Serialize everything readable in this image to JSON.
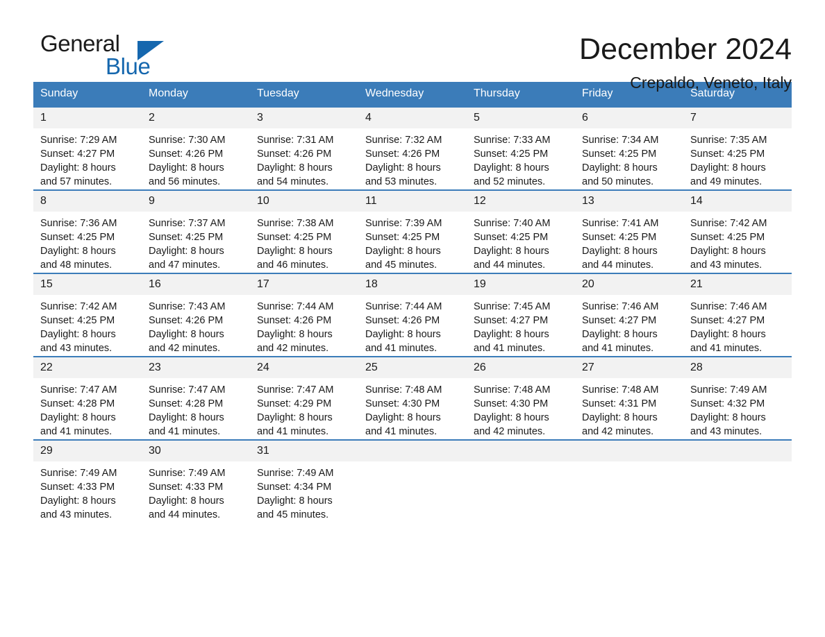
{
  "brand": {
    "name_part1": "General",
    "name_part2": "Blue",
    "triangle_color": "#1567ae"
  },
  "header": {
    "month_title": "December 2024",
    "location": "Crepaldo, Veneto, Italy"
  },
  "theme": {
    "header_blue": "#3b7cb9",
    "daynum_gray": "#f2f2f2",
    "text": "#1a1a1a"
  },
  "weekdays": [
    "Sunday",
    "Monday",
    "Tuesday",
    "Wednesday",
    "Thursday",
    "Friday",
    "Saturday"
  ],
  "weeks": [
    [
      {
        "day": "1",
        "sunrise": "Sunrise: 7:29 AM",
        "sunset": "Sunset: 4:27 PM",
        "daylight1": "Daylight: 8 hours",
        "daylight2": "and 57 minutes."
      },
      {
        "day": "2",
        "sunrise": "Sunrise: 7:30 AM",
        "sunset": "Sunset: 4:26 PM",
        "daylight1": "Daylight: 8 hours",
        "daylight2": "and 56 minutes."
      },
      {
        "day": "3",
        "sunrise": "Sunrise: 7:31 AM",
        "sunset": "Sunset: 4:26 PM",
        "daylight1": "Daylight: 8 hours",
        "daylight2": "and 54 minutes."
      },
      {
        "day": "4",
        "sunrise": "Sunrise: 7:32 AM",
        "sunset": "Sunset: 4:26 PM",
        "daylight1": "Daylight: 8 hours",
        "daylight2": "and 53 minutes."
      },
      {
        "day": "5",
        "sunrise": "Sunrise: 7:33 AM",
        "sunset": "Sunset: 4:25 PM",
        "daylight1": "Daylight: 8 hours",
        "daylight2": "and 52 minutes."
      },
      {
        "day": "6",
        "sunrise": "Sunrise: 7:34 AM",
        "sunset": "Sunset: 4:25 PM",
        "daylight1": "Daylight: 8 hours",
        "daylight2": "and 50 minutes."
      },
      {
        "day": "7",
        "sunrise": "Sunrise: 7:35 AM",
        "sunset": "Sunset: 4:25 PM",
        "daylight1": "Daylight: 8 hours",
        "daylight2": "and 49 minutes."
      }
    ],
    [
      {
        "day": "8",
        "sunrise": "Sunrise: 7:36 AM",
        "sunset": "Sunset: 4:25 PM",
        "daylight1": "Daylight: 8 hours",
        "daylight2": "and 48 minutes."
      },
      {
        "day": "9",
        "sunrise": "Sunrise: 7:37 AM",
        "sunset": "Sunset: 4:25 PM",
        "daylight1": "Daylight: 8 hours",
        "daylight2": "and 47 minutes."
      },
      {
        "day": "10",
        "sunrise": "Sunrise: 7:38 AM",
        "sunset": "Sunset: 4:25 PM",
        "daylight1": "Daylight: 8 hours",
        "daylight2": "and 46 minutes."
      },
      {
        "day": "11",
        "sunrise": "Sunrise: 7:39 AM",
        "sunset": "Sunset: 4:25 PM",
        "daylight1": "Daylight: 8 hours",
        "daylight2": "and 45 minutes."
      },
      {
        "day": "12",
        "sunrise": "Sunrise: 7:40 AM",
        "sunset": "Sunset: 4:25 PM",
        "daylight1": "Daylight: 8 hours",
        "daylight2": "and 44 minutes."
      },
      {
        "day": "13",
        "sunrise": "Sunrise: 7:41 AM",
        "sunset": "Sunset: 4:25 PM",
        "daylight1": "Daylight: 8 hours",
        "daylight2": "and 44 minutes."
      },
      {
        "day": "14",
        "sunrise": "Sunrise: 7:42 AM",
        "sunset": "Sunset: 4:25 PM",
        "daylight1": "Daylight: 8 hours",
        "daylight2": "and 43 minutes."
      }
    ],
    [
      {
        "day": "15",
        "sunrise": "Sunrise: 7:42 AM",
        "sunset": "Sunset: 4:25 PM",
        "daylight1": "Daylight: 8 hours",
        "daylight2": "and 43 minutes."
      },
      {
        "day": "16",
        "sunrise": "Sunrise: 7:43 AM",
        "sunset": "Sunset: 4:26 PM",
        "daylight1": "Daylight: 8 hours",
        "daylight2": "and 42 minutes."
      },
      {
        "day": "17",
        "sunrise": "Sunrise: 7:44 AM",
        "sunset": "Sunset: 4:26 PM",
        "daylight1": "Daylight: 8 hours",
        "daylight2": "and 42 minutes."
      },
      {
        "day": "18",
        "sunrise": "Sunrise: 7:44 AM",
        "sunset": "Sunset: 4:26 PM",
        "daylight1": "Daylight: 8 hours",
        "daylight2": "and 41 minutes."
      },
      {
        "day": "19",
        "sunrise": "Sunrise: 7:45 AM",
        "sunset": "Sunset: 4:27 PM",
        "daylight1": "Daylight: 8 hours",
        "daylight2": "and 41 minutes."
      },
      {
        "day": "20",
        "sunrise": "Sunrise: 7:46 AM",
        "sunset": "Sunset: 4:27 PM",
        "daylight1": "Daylight: 8 hours",
        "daylight2": "and 41 minutes."
      },
      {
        "day": "21",
        "sunrise": "Sunrise: 7:46 AM",
        "sunset": "Sunset: 4:27 PM",
        "daylight1": "Daylight: 8 hours",
        "daylight2": "and 41 minutes."
      }
    ],
    [
      {
        "day": "22",
        "sunrise": "Sunrise: 7:47 AM",
        "sunset": "Sunset: 4:28 PM",
        "daylight1": "Daylight: 8 hours",
        "daylight2": "and 41 minutes."
      },
      {
        "day": "23",
        "sunrise": "Sunrise: 7:47 AM",
        "sunset": "Sunset: 4:28 PM",
        "daylight1": "Daylight: 8 hours",
        "daylight2": "and 41 minutes."
      },
      {
        "day": "24",
        "sunrise": "Sunrise: 7:47 AM",
        "sunset": "Sunset: 4:29 PM",
        "daylight1": "Daylight: 8 hours",
        "daylight2": "and 41 minutes."
      },
      {
        "day": "25",
        "sunrise": "Sunrise: 7:48 AM",
        "sunset": "Sunset: 4:30 PM",
        "daylight1": "Daylight: 8 hours",
        "daylight2": "and 41 minutes."
      },
      {
        "day": "26",
        "sunrise": "Sunrise: 7:48 AM",
        "sunset": "Sunset: 4:30 PM",
        "daylight1": "Daylight: 8 hours",
        "daylight2": "and 42 minutes."
      },
      {
        "day": "27",
        "sunrise": "Sunrise: 7:48 AM",
        "sunset": "Sunset: 4:31 PM",
        "daylight1": "Daylight: 8 hours",
        "daylight2": "and 42 minutes."
      },
      {
        "day": "28",
        "sunrise": "Sunrise: 7:49 AM",
        "sunset": "Sunset: 4:32 PM",
        "daylight1": "Daylight: 8 hours",
        "daylight2": "and 43 minutes."
      }
    ],
    [
      {
        "day": "29",
        "sunrise": "Sunrise: 7:49 AM",
        "sunset": "Sunset: 4:33 PM",
        "daylight1": "Daylight: 8 hours",
        "daylight2": "and 43 minutes."
      },
      {
        "day": "30",
        "sunrise": "Sunrise: 7:49 AM",
        "sunset": "Sunset: 4:33 PM",
        "daylight1": "Daylight: 8 hours",
        "daylight2": "and 44 minutes."
      },
      {
        "day": "31",
        "sunrise": "Sunrise: 7:49 AM",
        "sunset": "Sunset: 4:34 PM",
        "daylight1": "Daylight: 8 hours",
        "daylight2": "and 45 minutes."
      },
      null,
      null,
      null,
      null
    ]
  ]
}
